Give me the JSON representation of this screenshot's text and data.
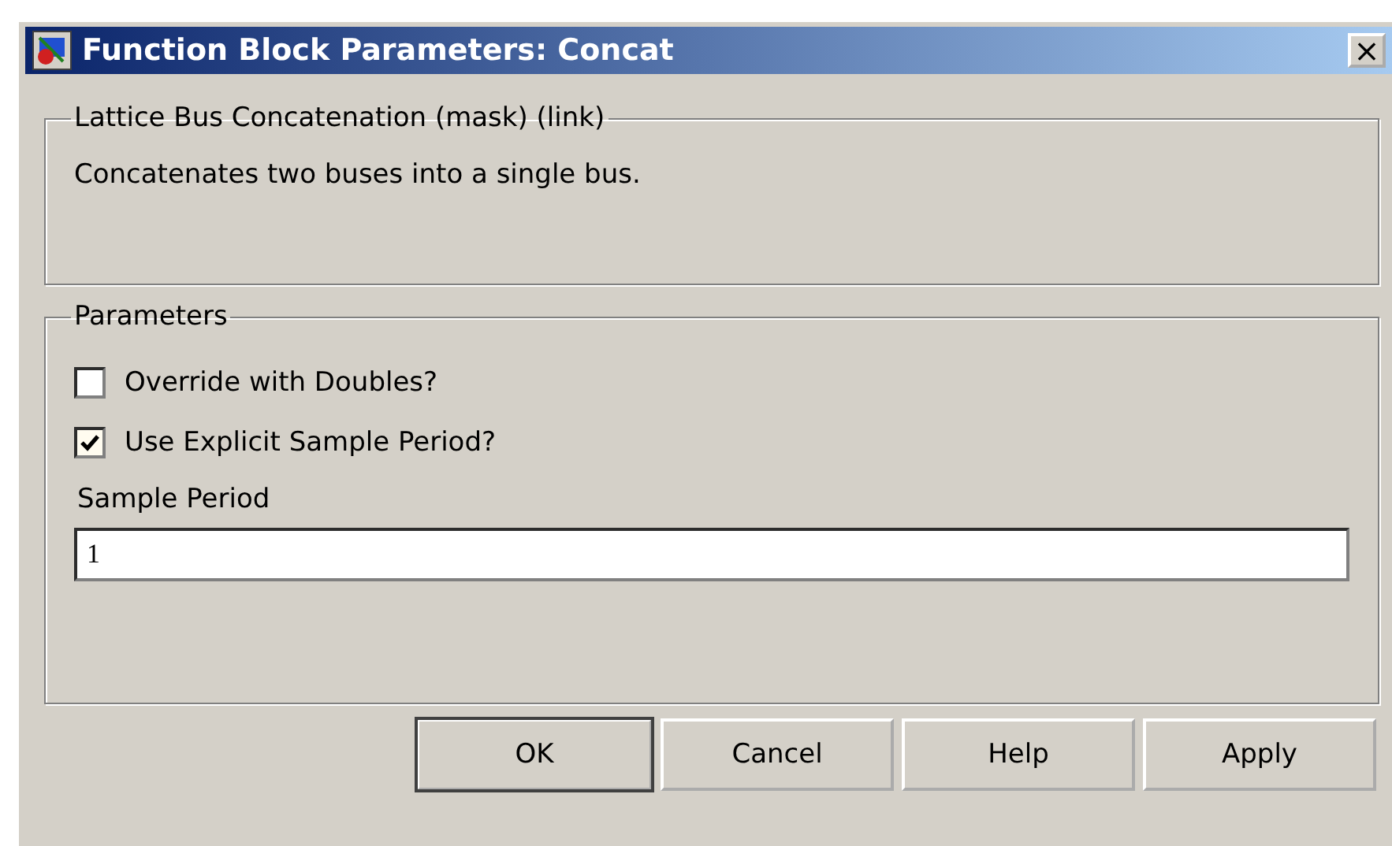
{
  "window": {
    "title": "Function Block Parameters: Concat",
    "close": "×"
  },
  "description": {
    "legend": "Lattice Bus Concatenation (mask) (link)",
    "text": "Concatenates two buses into a single bus."
  },
  "parameters": {
    "legend": "Parameters",
    "checkboxes": [
      {
        "label": "Override with Doubles?",
        "checked": false
      },
      {
        "label": "Use Explicit Sample Period?",
        "checked": true
      }
    ],
    "field": {
      "label": "Sample Period",
      "value": "1"
    }
  },
  "buttons": [
    {
      "label": "OK",
      "default": true
    },
    {
      "label": "Cancel",
      "default": false
    },
    {
      "label": "Help",
      "default": false
    },
    {
      "label": "Apply",
      "default": false
    }
  ]
}
